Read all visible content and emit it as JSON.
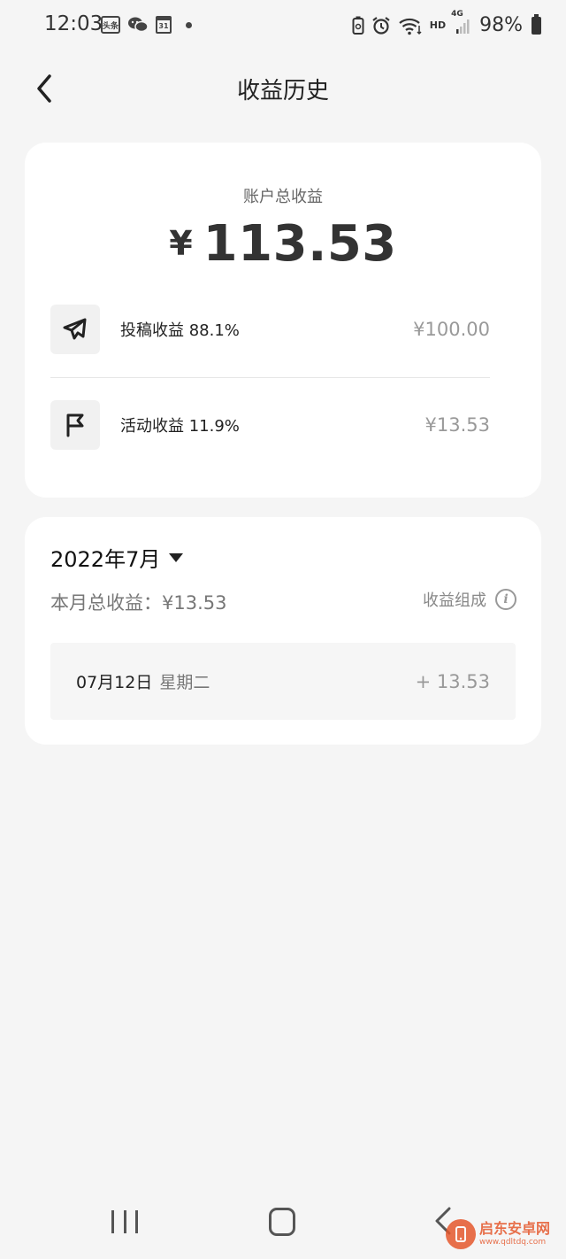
{
  "status_bar": {
    "time": "12:03",
    "toutiao_label": "头条",
    "calendar_day": "31",
    "hd_label": "HD",
    "network_label": "4G",
    "battery_percent": "98%"
  },
  "header": {
    "title": "收益历史"
  },
  "total_card": {
    "label": "账户总收益",
    "currency": "¥",
    "amount": "113.53",
    "rows": [
      {
        "icon": "paper-plane-icon",
        "label": "投稿收益 88.1%",
        "value": "¥100.00"
      },
      {
        "icon": "flag-icon",
        "label": "活动收益 11.9%",
        "value": "¥13.53"
      }
    ]
  },
  "month_card": {
    "month_selector": "2022年7月",
    "month_total": "本月总收益：¥13.53",
    "composition_link": "收益组成",
    "info_glyph": "i",
    "days": [
      {
        "date": "07月12日",
        "weekday": "星期二",
        "value": "+ 13.53"
      }
    ]
  },
  "watermark": {
    "title": "启东安卓网",
    "url": "www.qdltdq.com"
  },
  "colors": {
    "background": "#f5f5f5",
    "card": "#ffffff",
    "muted_text": "#999999",
    "watermark": "#e5582d"
  }
}
